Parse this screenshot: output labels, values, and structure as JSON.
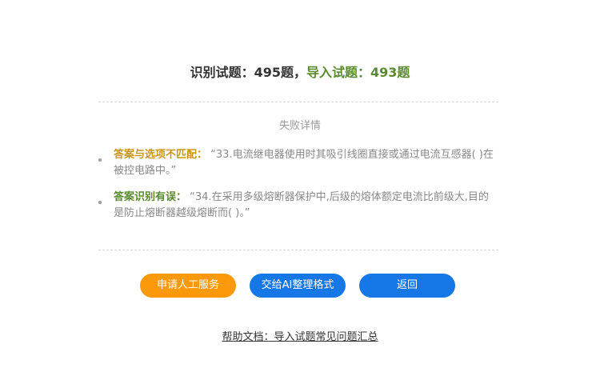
{
  "summary": {
    "recognized": "识别试题：495题",
    "separator": "，",
    "imported": "导入试题：493题"
  },
  "details": {
    "title": "失败详情",
    "items": [
      {
        "reason": "答案与选项不匹配：",
        "question": "“33.电流继电器使用时其吸引线圈直接或通过电流互感器( )在被控电路中。”"
      },
      {
        "reason": "答案识别有误：",
        "question": "“34.在采用多级熔断器保护中,后级的熔体额定电流比前级大,目的是防止熔断器越级熔断而( )。”"
      }
    ]
  },
  "buttons": {
    "manual": "申请人工服务",
    "ai": "交给AI整理格式",
    "back": "返回"
  },
  "help": {
    "link": "帮助文档：导入试题常见问题汇总"
  },
  "colors": {
    "orange": "#fa9a0a",
    "blue": "#1678e6",
    "green": "#5a8a2e",
    "gold": "#c8951a"
  }
}
